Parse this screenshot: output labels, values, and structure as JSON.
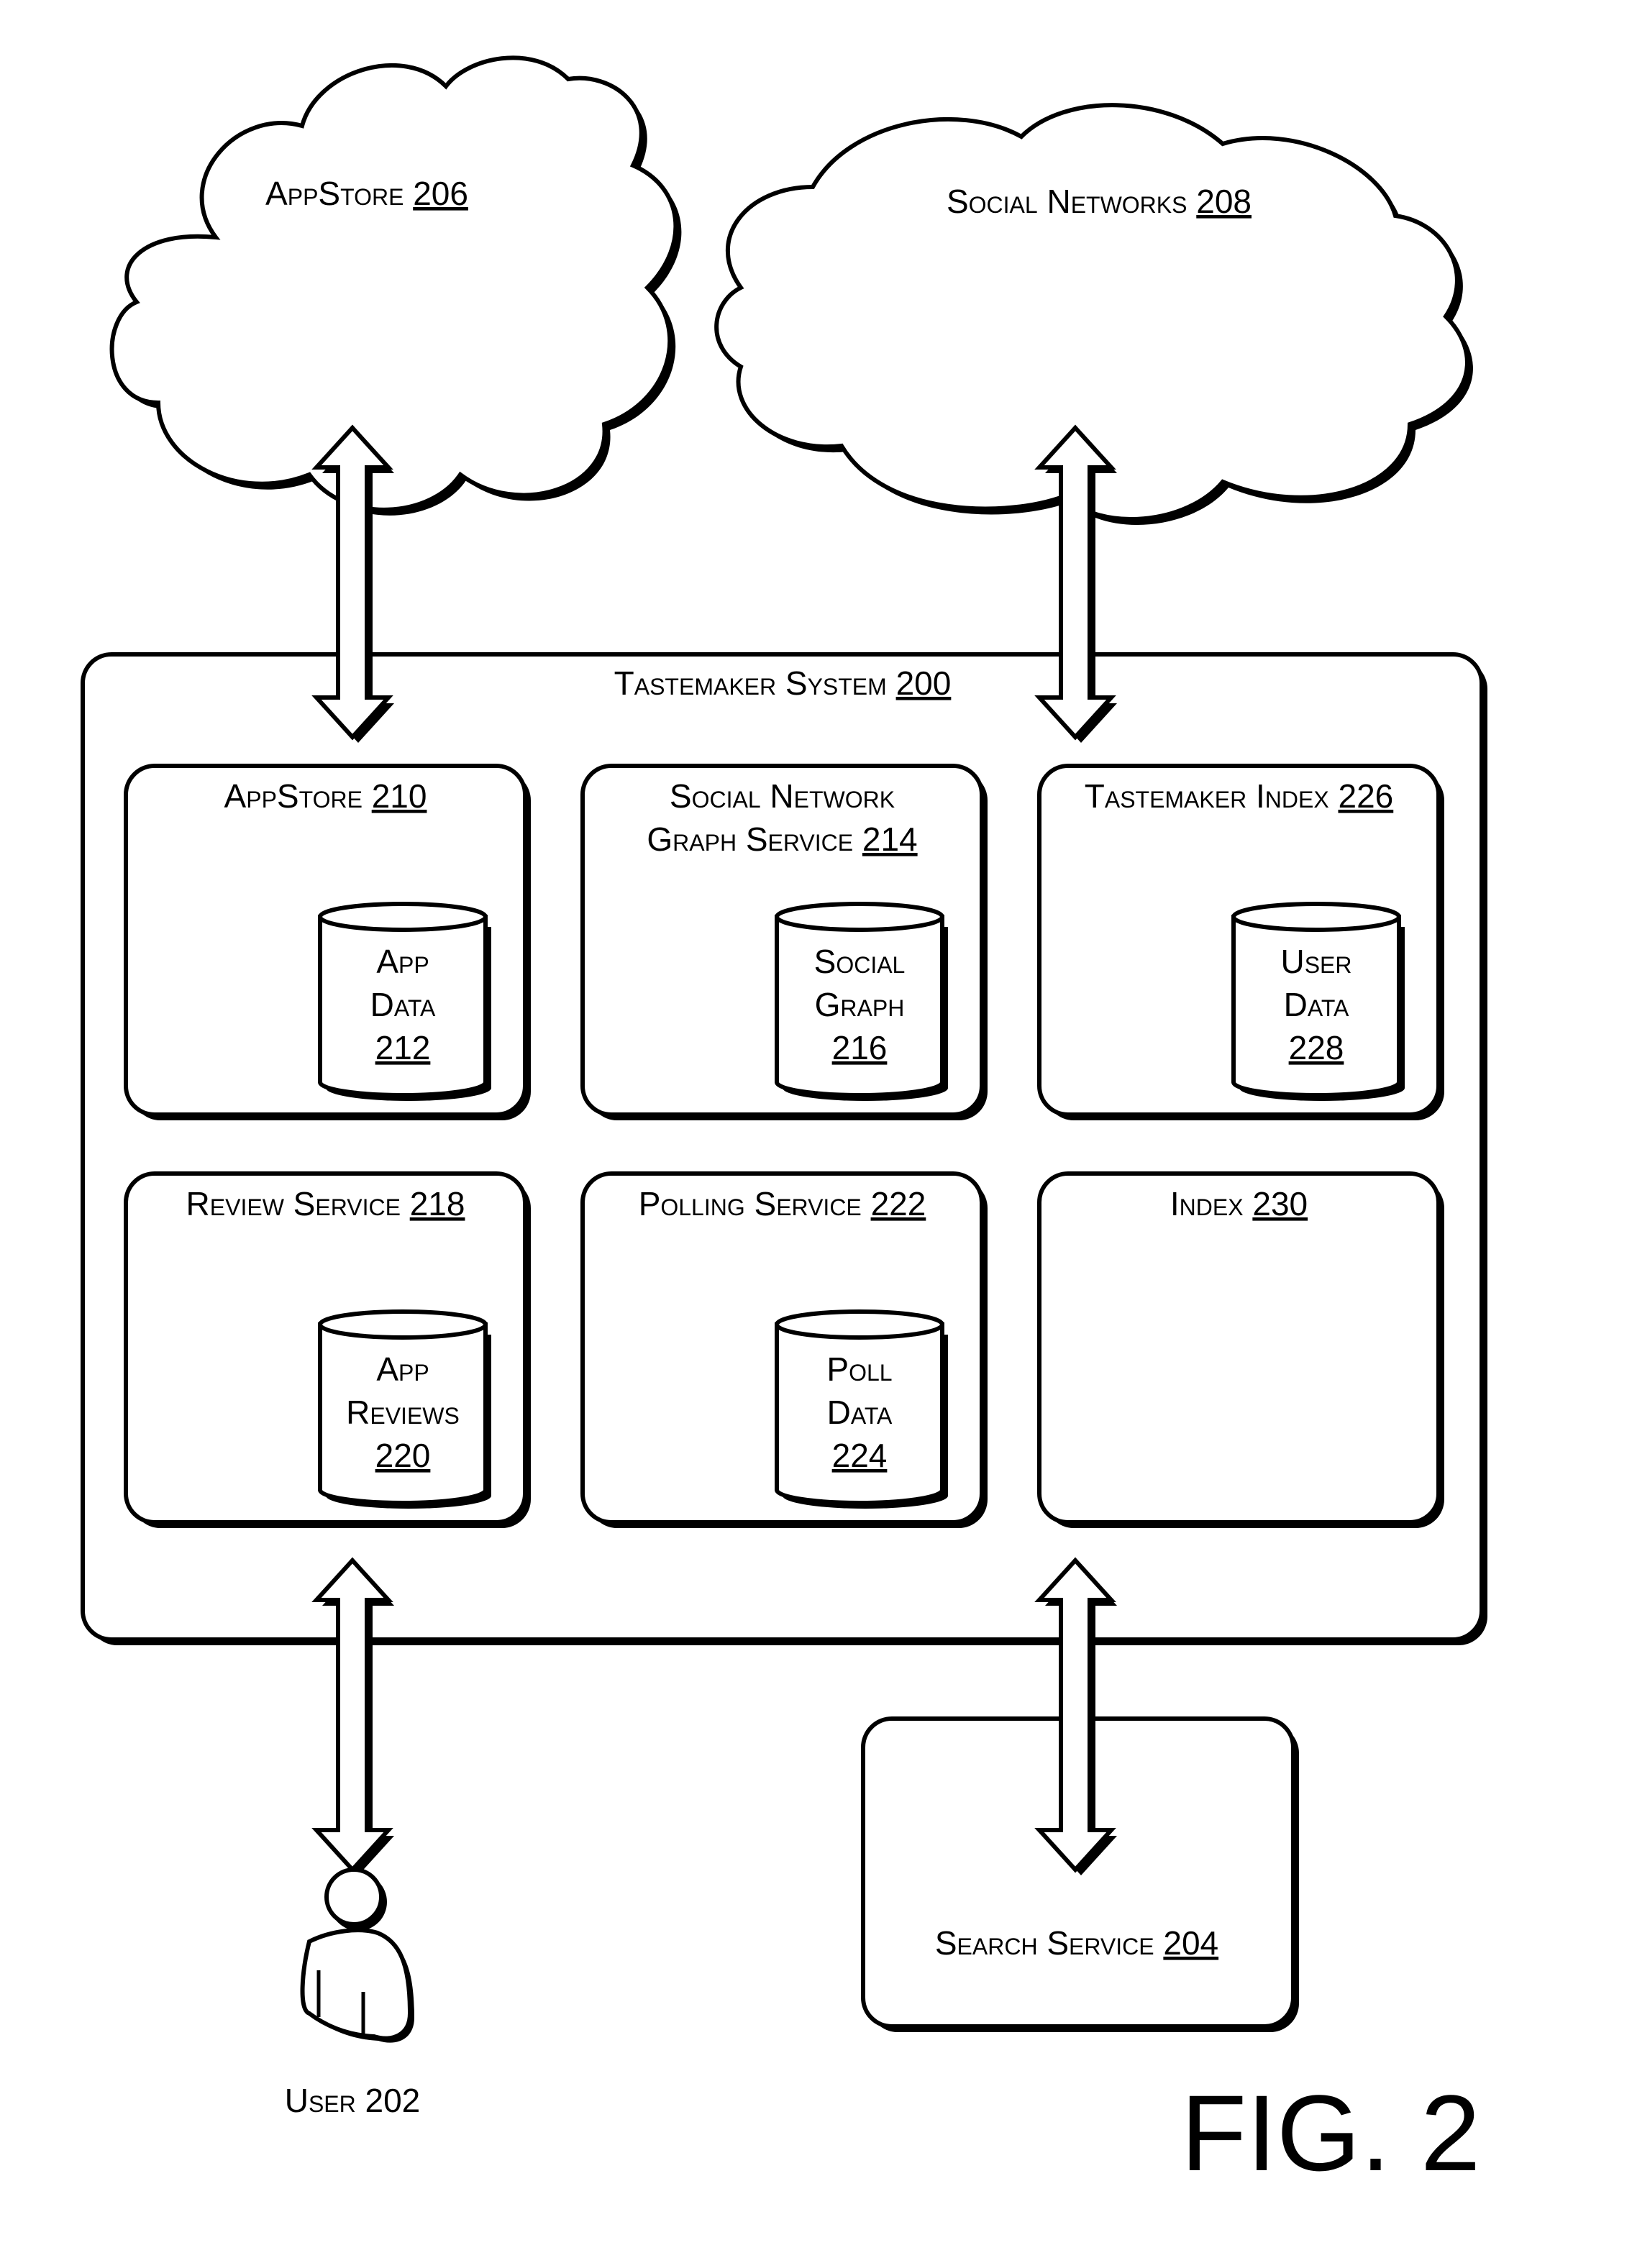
{
  "figure_label": "FIG. 2",
  "clouds": [
    {
      "id": "appstore-cloud",
      "name": "AppStore",
      "ref": "206"
    },
    {
      "id": "social-networks-cloud",
      "name": "Social Networks",
      "ref": "208"
    }
  ],
  "system": {
    "name": "Tastemaker System",
    "ref": "200"
  },
  "components": [
    {
      "name_lines": [
        "AppStore"
      ],
      "ref": "210",
      "store": {
        "lines": [
          "App",
          "Data"
        ],
        "ref": "212"
      }
    },
    {
      "name_lines": [
        "Social Network",
        "Graph Service"
      ],
      "ref": "214",
      "store": {
        "lines": [
          "Social",
          "Graph"
        ],
        "ref": "216"
      }
    },
    {
      "name_lines": [
        "Tastemaker Index"
      ],
      "ref": "226",
      "store": {
        "lines": [
          "User",
          "Data"
        ],
        "ref": "228"
      }
    },
    {
      "name_lines": [
        "Review Service"
      ],
      "ref": "218",
      "store": {
        "lines": [
          "App",
          "Reviews"
        ],
        "ref": "220"
      }
    },
    {
      "name_lines": [
        "Polling Service"
      ],
      "ref": "222",
      "store": {
        "lines": [
          "Poll",
          "Data"
        ],
        "ref": "224"
      }
    },
    {
      "name_lines": [
        "Index"
      ],
      "ref": "230",
      "store": null
    }
  ],
  "search_service": {
    "name": "Search Service",
    "ref": "204"
  },
  "user": {
    "label": "User 202"
  },
  "connections": [
    {
      "from": "AppStore 206",
      "to": "Tastemaker System 200",
      "direction": "bidirectional"
    },
    {
      "from": "Social Networks 208",
      "to": "Tastemaker System 200",
      "direction": "bidirectional"
    },
    {
      "from": "Tastemaker System 200",
      "to": "User 202",
      "direction": "bidirectional"
    },
    {
      "from": "Tastemaker System 200",
      "to": "Search Service 204",
      "direction": "bidirectional"
    }
  ]
}
